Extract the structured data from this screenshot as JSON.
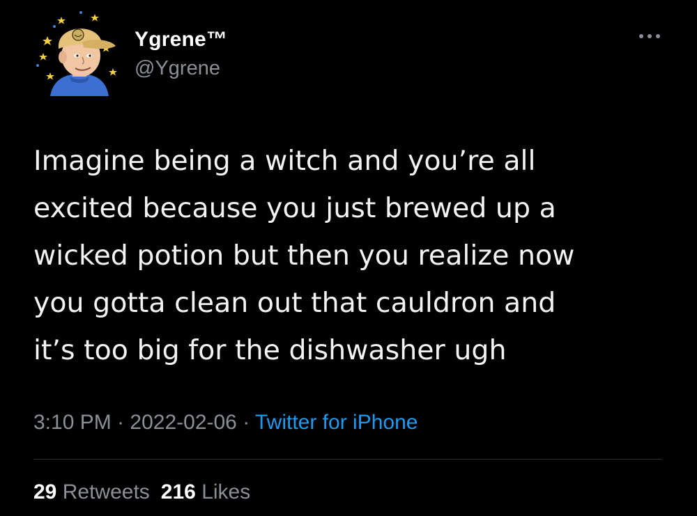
{
  "author": {
    "display_name": "Ygrene™",
    "handle": "@Ygrene",
    "avatar_icon": "cartoon-avatar-icon"
  },
  "menu_icon": "more-options-icon",
  "tweet": {
    "text": "Imagine being a witch and you’re all\nexcited because you just brewed up a\nwicked potion but then you realize now\nyou gotta clean out that cauldron and\nit’s too big for the dishwasher ugh",
    "time": "3:10 PM",
    "separator": " · ",
    "date": "2022-02-06",
    "source": "Twitter for iPhone"
  },
  "stats": {
    "retweets_count": "29",
    "retweets_label": "Retweets",
    "likes_count": "216",
    "likes_label": "Likes"
  },
  "colors": {
    "background": "#000000",
    "text": "#f2f3f4",
    "muted": "#8b9097",
    "link": "#1d9bf0"
  }
}
